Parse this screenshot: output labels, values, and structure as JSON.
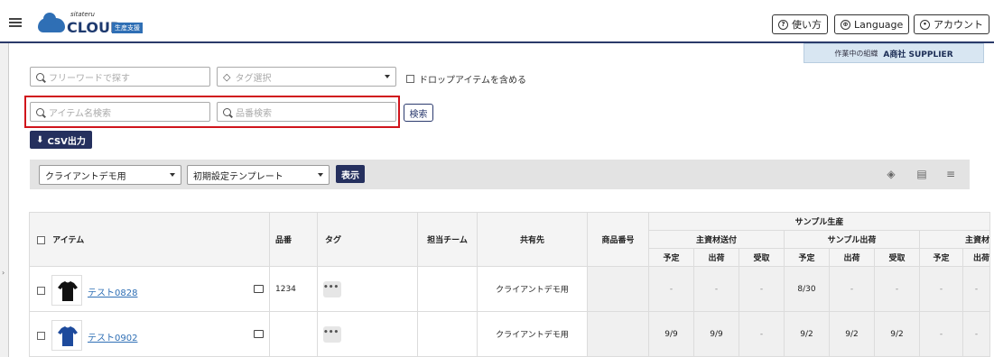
{
  "header": {
    "logo_small": "sitateru",
    "logo_text": "CLOUD",
    "logo_badge": "生産支援",
    "help_label": "使い方",
    "language_label": "Language",
    "account_label": "アカウント",
    "org_prefix": "作業中の組織",
    "org_name": "A商社 SUPPLIER"
  },
  "filters": {
    "freeword_placeholder": "フリーワードで探す",
    "tag_placeholder": "タグ選択",
    "include_dropped_label": "ドロップアイテムを含める",
    "item_name_placeholder": "アイテム名検索",
    "part_number_placeholder": "品番検索",
    "search_button": "検索",
    "csv_button": "CSV出力"
  },
  "view": {
    "client_select": "クライアントデモ用",
    "template_select": "初期設定テンプレート",
    "show_button": "表示"
  },
  "table": {
    "headers": {
      "item": "アイテム",
      "part_no": "品番",
      "tag": "タグ",
      "team": "担当チーム",
      "shared": "共有先",
      "product_no": "商品番号",
      "sample_production": "サンプル生産",
      "main_material_send": "主資材送付",
      "sample_ship": "サンプル出荷",
      "main_material_2": "主資材",
      "plan": "予定",
      "ship": "出荷",
      "receive": "受取",
      "ship_short": "出荷"
    },
    "rows": [
      {
        "name": "テスト0828",
        "part_no": "1234",
        "tag_more": "•••",
        "shared": "クライアントデモ用",
        "cells": [
          "-",
          "-",
          "-",
          "8/30",
          "-",
          "-",
          "-",
          "-"
        ]
      },
      {
        "name": "テスト0902",
        "part_no": "",
        "tag_more": "•••",
        "shared": "クライアントデモ用",
        "cells": [
          "9/9",
          "9/9",
          "-",
          "9/2",
          "9/2",
          "9/2",
          "-",
          "-"
        ]
      }
    ]
  },
  "colors": {
    "navy": "#25305e",
    "link": "#2f6fb5",
    "highlight": "#d0141b"
  }
}
